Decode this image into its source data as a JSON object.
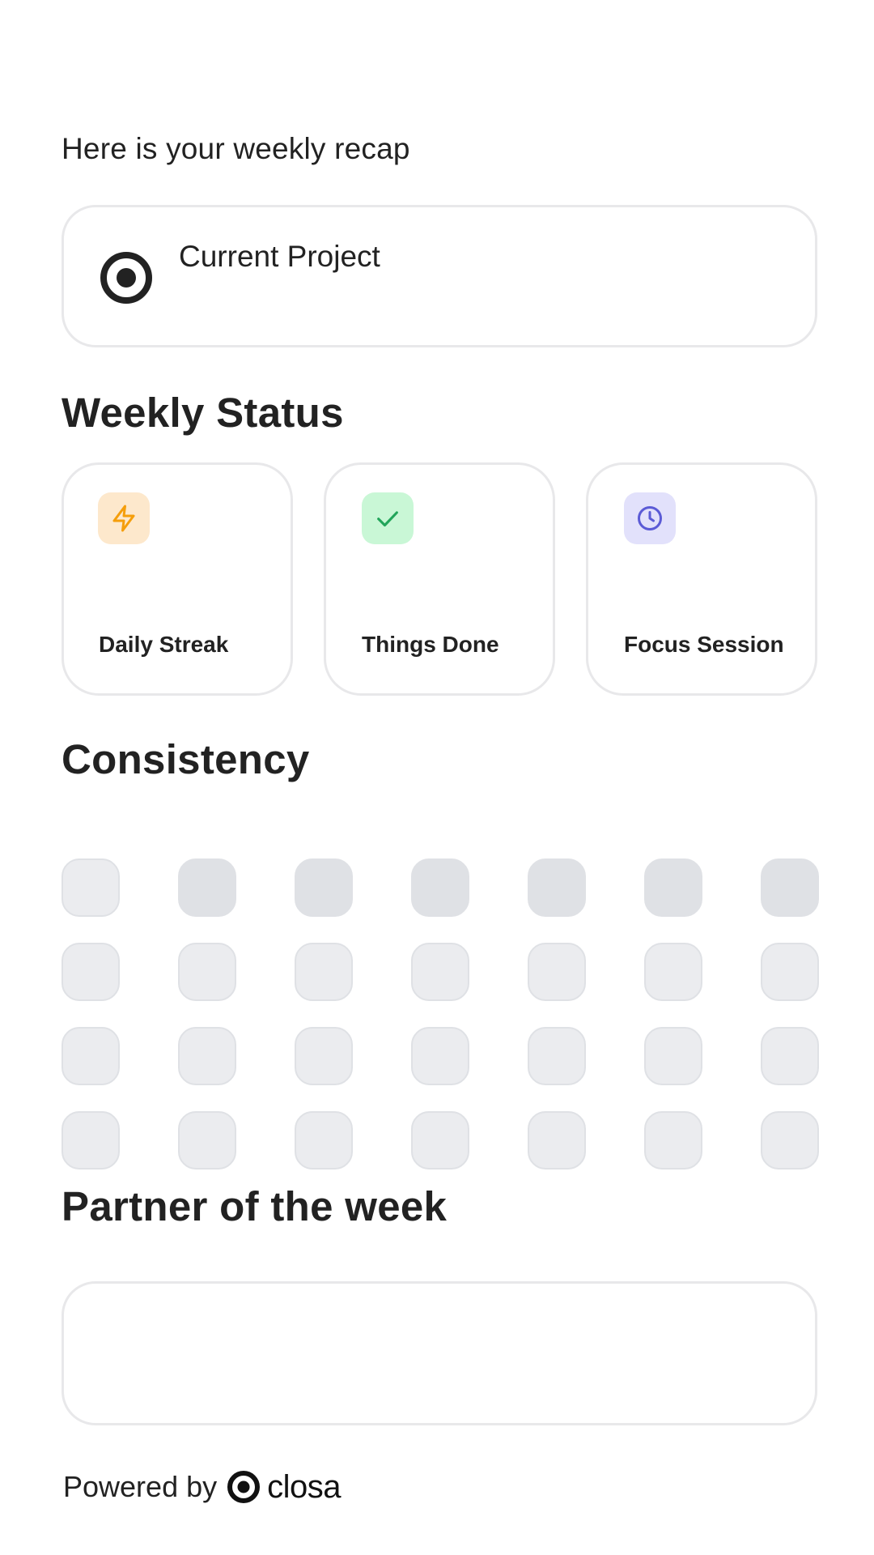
{
  "intro": {
    "text": "Here is your weekly recap"
  },
  "project": {
    "label": "Current Project",
    "icon": "target-icon"
  },
  "weekly_status": {
    "title": "Weekly Status",
    "cards": [
      {
        "label": "Daily Streak",
        "icon": "lightning-icon",
        "icon_bg": "#fde8cc",
        "icon_color": "#f59e0b"
      },
      {
        "label": "Things Done",
        "icon": "check-icon",
        "icon_bg": "#c9f7d6",
        "icon_color": "#22a55a"
      },
      {
        "label": "Focus Session",
        "icon": "clock-icon",
        "icon_bg": "#e2e1fb",
        "icon_color": "#5b5bd6"
      }
    ]
  },
  "consistency": {
    "title": "Consistency",
    "rows": 4,
    "cols": 7
  },
  "partner": {
    "title": "Partner of the week"
  },
  "footer": {
    "powered_by": "Powered by",
    "brand": "closa"
  }
}
